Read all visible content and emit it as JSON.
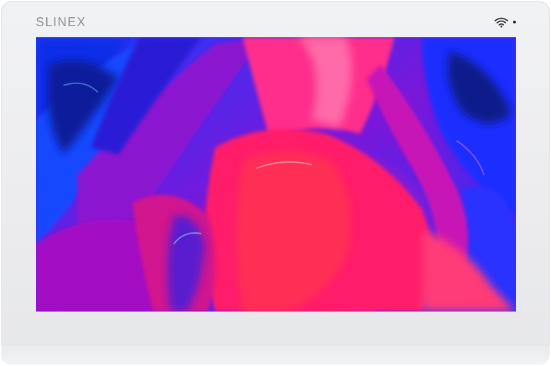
{
  "device": {
    "brand_label": "SLINEX",
    "status_icon": "wifi-icon",
    "indicator": "camera-sensor-dot"
  },
  "screen": {
    "content": "abstract-paint-wallpaper",
    "colors": [
      "#ff1f6b",
      "#e0128d",
      "#8a1fd6",
      "#3a2bff",
      "#1a5cff",
      "#0b1a8a"
    ]
  }
}
